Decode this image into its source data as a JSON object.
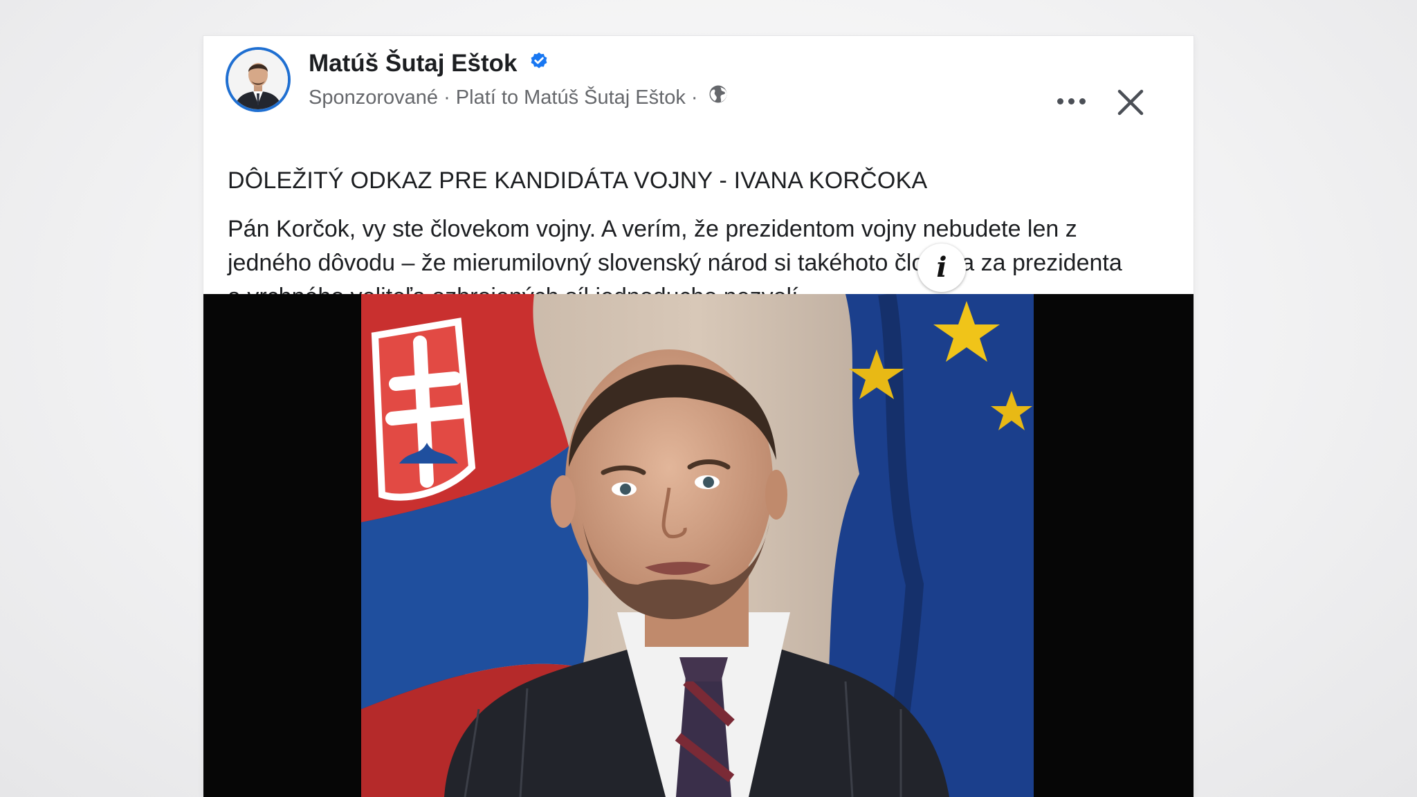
{
  "post": {
    "author_name": "Matúš Šutaj Eštok",
    "meta_text": "Sponzorované · Platí to Matúš Šutaj Eštok ·",
    "headline": "DÔLEŽITÝ ODKAZ PRE KANDIDÁTA VOJNY - IVANA KORČOKA",
    "body": "Pán Korčok, vy ste človekom vojny. A verím, že prezidentom vojny nebudete len z jedného dôvodu – že mierumilovný slovenský národ si takéhoto človeka za prezidenta a vrchného veliteľa ozbrojených síl jednoducho nezvolí.",
    "info_label": "i"
  },
  "icons": {
    "verified": "verified-badge-icon",
    "audience": "globe-icon",
    "more": "more-options-icon",
    "close": "close-icon",
    "info": "info-icon"
  },
  "colors": {
    "verified_blue": "#1877f2",
    "avatar_ring": "#1f6fd1",
    "meta_gray": "#65676b",
    "text": "#1c1e21"
  }
}
